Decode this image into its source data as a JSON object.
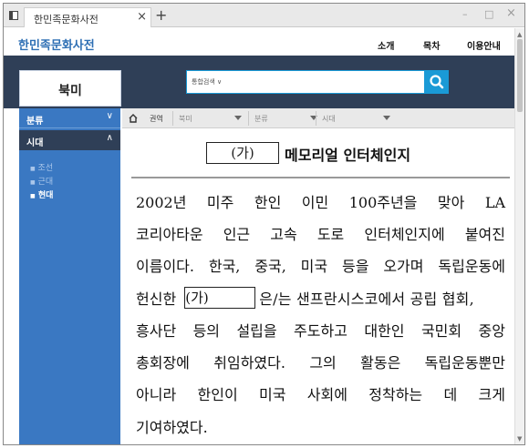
{
  "browser": {
    "tab_title": "한민족문화사전",
    "tab_close": "×",
    "new_tab": "+",
    "minimize": "–",
    "maximize": "□",
    "close": "×"
  },
  "site": {
    "title": "한민족문화사전",
    "nav": [
      "소개",
      "목차",
      "이용안내"
    ]
  },
  "search": {
    "category": "통합검색 ∨",
    "value": "",
    "button_icon": "search-icon"
  },
  "page_title": "북미",
  "sidebar": {
    "sections": [
      {
        "label": "분류",
        "chevron": "∨"
      },
      {
        "label": "시대",
        "chevron": "∧"
      }
    ],
    "era_items": [
      "조선",
      "근대",
      "현대"
    ],
    "active_item": "현대",
    "bullet": "■"
  },
  "filters": {
    "home_icon": "home-icon",
    "label": "권역",
    "selects": [
      "북미",
      "분류",
      "시대"
    ]
  },
  "article": {
    "blank_label": "(가)",
    "title": "메모리얼 인터체인지",
    "lines": [
      "2002년 미주 한인 이민 100주년을 맞아 LA",
      "코리아타운 인근 고속 도로 인터체인지에 붙여진",
      "이름이다. 한국, 중국, 미국 등을 오가며 독립운동에",
      "헌신한",
      "(가)",
      "은/는 샌프란시스코에서 공립 협회,",
      "흥사단 등의 설립을 주도하고 대한인 국민회 중앙",
      "총회장에 취임하였다. 그의 활동은 독립운동뿐만",
      "아니라 한인이 미국 사회에 정착하는 데 크게",
      "기여하였다."
    ]
  },
  "colors": {
    "banner": "#2f3f57",
    "sidebar": "#3a78c2",
    "sidebar_header": "#2f3f57",
    "accent": "#1a9ad6",
    "site_title": "#2e6fb4"
  }
}
